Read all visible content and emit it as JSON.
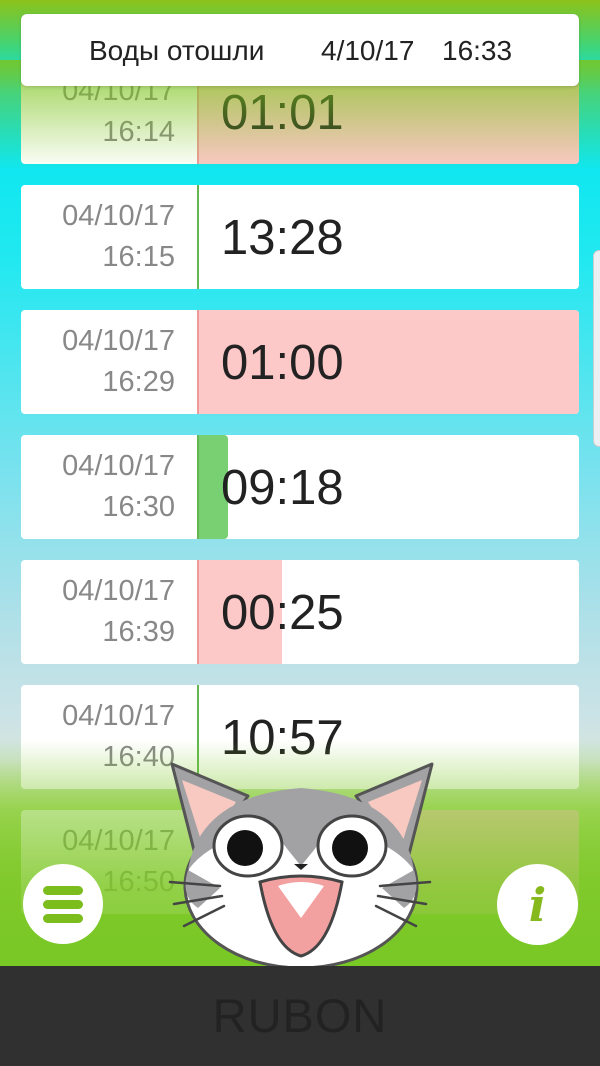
{
  "header": {
    "label": "Воды отошли",
    "date": "4/10/17",
    "time": "16:33"
  },
  "rows": [
    {
      "date": "04/10/17",
      "time": "16:14",
      "duration": "01:01",
      "fill": 1.0,
      "fill_color": "pink"
    },
    {
      "date": "04/10/17",
      "time": "16:15",
      "duration": "13:28",
      "fill": 0.0,
      "fill_color": "green"
    },
    {
      "date": "04/10/17",
      "time": "16:29",
      "duration": "01:00",
      "fill": 1.0,
      "fill_color": "pink"
    },
    {
      "date": "04/10/17",
      "time": "16:30",
      "duration": "09:18",
      "fill": 0.08,
      "fill_color": "green"
    },
    {
      "date": "04/10/17",
      "time": "16:39",
      "duration": "00:25",
      "fill": 0.22,
      "fill_color": "pink"
    },
    {
      "date": "04/10/17",
      "time": "16:40",
      "duration": "10:57",
      "fill": 0.0,
      "fill_color": "green"
    },
    {
      "date": "04/10/17",
      "time": "16:50",
      "duration": "",
      "fill": 1.0,
      "fill_color": "pink"
    }
  ],
  "colors": {
    "accent": "#7cbd1e",
    "pink": "#fdc8c8",
    "green": "#78d072"
  },
  "icons": {
    "menu": "hamburger-icon",
    "info": "info-icon",
    "mascot": "cat-mascot"
  },
  "info_glyph": "i",
  "footer": {
    "brand": "RUBON"
  }
}
